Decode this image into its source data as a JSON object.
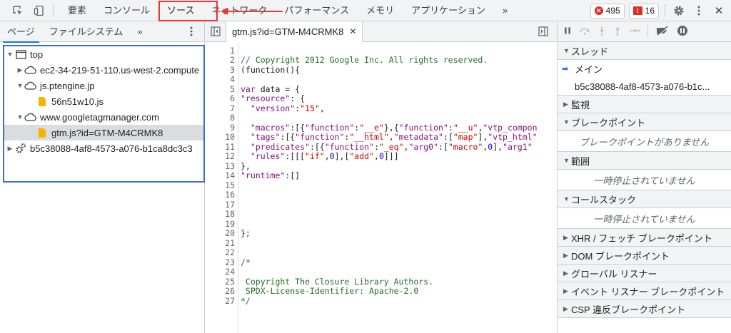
{
  "toolbar": {
    "tabs": [
      "要素",
      "コンソール",
      "ソース",
      "ネットワーク",
      "パフォーマンス",
      "メモリ",
      "アプリケーション"
    ],
    "more": "»",
    "errors": "495",
    "issues": "16",
    "close": "✕"
  },
  "left": {
    "tabs": [
      "ページ",
      "ファイルシステム"
    ],
    "more": "»",
    "tree": [
      {
        "label": "top"
      },
      {
        "label": "ec2-34-219-51-110.us-west-2.compute"
      },
      {
        "label": "js.ptengine.jp"
      },
      {
        "label": "56n51w10.js"
      },
      {
        "label": "www.googletagmanager.com"
      },
      {
        "label": "gtm.js?id=GTM-M4CRMK8"
      },
      {
        "label": "b5c38088-4af8-4573-a076-b1ca8dc3c3"
      }
    ]
  },
  "editor": {
    "file_tab": "gtm.js?id=GTM-M4CRMK8",
    "close": "✕",
    "line_numbers": [
      "1",
      "2",
      "3",
      "4",
      "5",
      "6",
      "7",
      "8",
      "9",
      "10",
      "11",
      "12",
      "13",
      "14",
      "15",
      "16",
      "17",
      "18",
      "19",
      "20",
      "21",
      "22",
      "23",
      "24",
      "25",
      "26",
      "27"
    ]
  },
  "code": {
    "l2": "// Copyright 2012 Google Inc. All rights reserved.",
    "l3": "(function(){",
    "l5a": "var",
    "l5b": " data = {",
    "l6a": "\"resource\"",
    "l6b": ": {",
    "l7a": "  \"version\"",
    "l7b": ":",
    "l7c": "\"15\"",
    "l7d": ",",
    "l9a": "  \"macros\"",
    "l9b": ":[{",
    "l9c": "\"function\"",
    "l9d": ":",
    "l9e": "\"__e\"",
    "l9f": "},{",
    "l9g": "\"function\"",
    "l9h": ":",
    "l9i": "\"__u\"",
    "l9j": ",",
    "l9k": "\"vtp_compon",
    "l10a": "  \"tags\"",
    "l10b": ":[{",
    "l10c": "\"function\"",
    "l10d": ":",
    "l10e": "\"__html\"",
    "l10f": ",",
    "l10g": "\"metadata\"",
    "l10h": ":[",
    "l10i": "\"map\"",
    "l10j": "],",
    "l10k": "\"vtp_html\"",
    "l11a": "  \"predicates\"",
    "l11b": ":[{",
    "l11c": "\"function\"",
    "l11d": ":",
    "l11e": "\"_eq\"",
    "l11f": ",",
    "l11g": "\"arg0\"",
    "l11h": ":[",
    "l11i": "\"macro\"",
    "l11j": ",",
    "l11k": "0",
    "l11l": "],",
    "l11m": "\"arg1\"",
    "l12a": "  \"rules\"",
    "l12b": ":[[[",
    "l12c": "\"if\"",
    "l12d": ",",
    "l12e": "0",
    "l12f": "],[",
    "l12g": "\"add\"",
    "l12h": ",",
    "l12i": "0",
    "l12j": "]]]",
    "l13": "},",
    "l14a": "\"runtime\"",
    "l14b": ":[]",
    "l20": "};",
    "l23": "/*",
    "l25": " Copyright The Closure Library Authors.",
    "l26": " SPDX-License-Identifier: Apache-2.0",
    "l27": "*/"
  },
  "debugger": {
    "threads": "スレッド",
    "main": "メイン",
    "worker": "b5c38088-4af8-4573-a076-b1c...",
    "watch": "監視",
    "breakpoints": "ブレークポイント",
    "no_breakpoints": "ブレークポイントがありません",
    "scope": "範囲",
    "not_paused_1": "一時停止されていません",
    "callstack": "コールスタック",
    "not_paused_2": "一時停止されていません",
    "xhr": "XHR / フェッチ ブレークポイント",
    "dom": "DOM ブレークポイント",
    "global": "グローバル リスナー",
    "event": "イベント リスナー ブレークポイント",
    "csp": "CSP 違反ブレークポイント"
  }
}
